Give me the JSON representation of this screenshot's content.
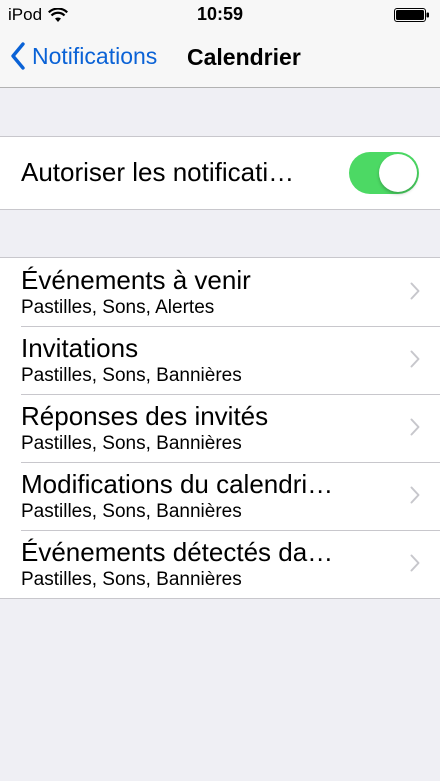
{
  "status_bar": {
    "carrier": "iPod",
    "time": "10:59",
    "icons": [
      "wifi-icon",
      "battery-icon"
    ]
  },
  "nav": {
    "back_label": "Notifications",
    "title": "Calendrier"
  },
  "allow_notifications": {
    "label": "Autoriser les notificati…",
    "enabled": true,
    "switch_color": "#4cd964"
  },
  "items": [
    {
      "title": "Événements à venir",
      "subtitle": "Pastilles, Sons, Alertes"
    },
    {
      "title": "Invitations",
      "subtitle": "Pastilles, Sons, Bannières"
    },
    {
      "title": "Réponses des invités",
      "subtitle": "Pastilles, Sons, Bannières"
    },
    {
      "title": "Modifications du calendri…",
      "subtitle": "Pastilles, Sons, Bannières"
    },
    {
      "title": "Événements détectés da…",
      "subtitle": "Pastilles, Sons, Bannières"
    }
  ],
  "colors": {
    "accent": "#0a62d6",
    "background": "#efeff4",
    "chevron": "#c7c7cc"
  }
}
